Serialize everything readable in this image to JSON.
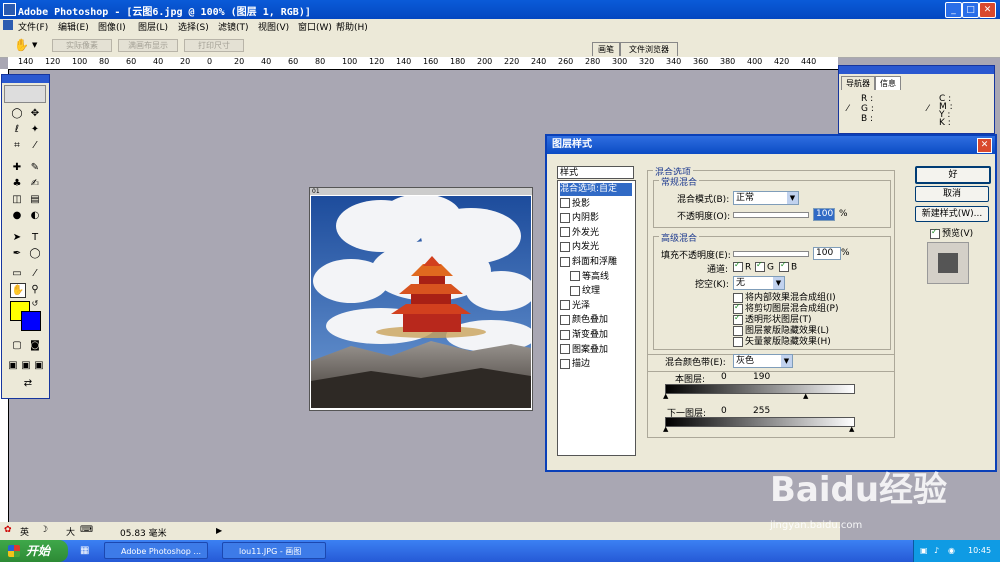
{
  "window": {
    "title": "Adobe Photoshop - [云图6.jpg @ 100% (图层 1, RGB)]",
    "minimize": "_",
    "maximize": "□",
    "close": "✕"
  },
  "menu": [
    "文件(F)",
    "编辑(E)",
    "图像(I)",
    "图层(L)",
    "选择(S)",
    "滤镜(T)",
    "视图(V)",
    "窗口(W)",
    "帮助(H)"
  ],
  "options": {
    "actual_pixels": "实际像素",
    "fit_screen": "满画布显示",
    "print_size": "打印尺寸",
    "tab_brush": "画笔",
    "tab_browser": "文件浏览器"
  },
  "ruler_ticks": [
    "140",
    "120",
    "100",
    "80",
    "60",
    "40",
    "20",
    "0",
    "20",
    "40",
    "60",
    "80",
    "100",
    "120",
    "140",
    "160",
    "180",
    "200",
    "220",
    "240",
    "260",
    "280",
    "300",
    "320",
    "340",
    "360",
    "380",
    "400",
    "420",
    "440"
  ],
  "navigator": {
    "tab_nav": "导航器",
    "tab_info": "信息",
    "rgb": [
      "R :",
      "G :",
      "B :"
    ],
    "cmyk": [
      "C :",
      "M :",
      "Y :",
      "K :"
    ]
  },
  "document": {
    "badge": "01"
  },
  "dialog": {
    "title": "图层样式",
    "list_header": "样式",
    "list": [
      {
        "label": "混合选项:自定",
        "checked": null,
        "selected": true,
        "indent": false
      },
      {
        "label": "投影",
        "checked": false,
        "selected": false,
        "indent": false
      },
      {
        "label": "内阴影",
        "checked": false,
        "selected": false,
        "indent": false
      },
      {
        "label": "外发光",
        "checked": false,
        "selected": false,
        "indent": false
      },
      {
        "label": "内发光",
        "checked": false,
        "selected": false,
        "indent": false
      },
      {
        "label": "斜面和浮雕",
        "checked": false,
        "selected": false,
        "indent": false
      },
      {
        "label": "等高线",
        "checked": false,
        "selected": false,
        "indent": true
      },
      {
        "label": "纹理",
        "checked": false,
        "selected": false,
        "indent": true
      },
      {
        "label": "光泽",
        "checked": false,
        "selected": false,
        "indent": false
      },
      {
        "label": "颜色叠加",
        "checked": false,
        "selected": false,
        "indent": false
      },
      {
        "label": "渐变叠加",
        "checked": false,
        "selected": false,
        "indent": false
      },
      {
        "label": "图案叠加",
        "checked": false,
        "selected": false,
        "indent": false
      },
      {
        "label": "描边",
        "checked": false,
        "selected": false,
        "indent": false
      }
    ],
    "blend_options": "混合选项",
    "general_blend": "常规混合",
    "blend_mode_label": "混合模式(B):",
    "blend_mode_value": "正常",
    "opacity_label": "不透明度(O):",
    "opacity_value": "100",
    "percent": "%",
    "advanced_blend": "高级混合",
    "fill_opacity_label": "填充不透明度(E):",
    "fill_opacity_value": "100",
    "channels_label": "通道:",
    "channels": [
      "R",
      "G",
      "B"
    ],
    "knockout_label": "挖空(K):",
    "knockout_value": "无",
    "adv_checks": [
      {
        "label": "将内部效果混合成组(I)",
        "checked": false
      },
      {
        "label": "将剪切图层混合成组(P)",
        "checked": true
      },
      {
        "label": "透明形状图层(T)",
        "checked": true
      },
      {
        "label": "图层蒙版隐藏效果(L)",
        "checked": false
      },
      {
        "label": "矢量蒙版隐藏效果(H)",
        "checked": false
      }
    ],
    "blend_if_label": "混合颜色带(E):",
    "blend_if_value": "灰色",
    "this_layer_label": "本图层:",
    "this_layer_low": "0",
    "this_layer_high": "190",
    "under_layer_label": "下一图层:",
    "under_layer_low": "0",
    "under_layer_high": "255",
    "ok": "好",
    "cancel": "取消",
    "new_style": "新建样式(W)...",
    "preview": "预览(V)"
  },
  "status": {
    "ime": "英",
    "ime_extra": "大",
    "value": "05.83 毫米"
  },
  "taskbar": {
    "start": "开始",
    "tasks": [
      "Adobe Photoshop ...",
      "lou11.JPG - 画图"
    ],
    "clock": "10:45"
  },
  "watermark": {
    "brand": "Baidu经验",
    "url": "jingyan.baidu.com"
  },
  "colors": {
    "titlebar": "#0a5bd8",
    "foreground_swatch": "#ffff00",
    "background_swatch": "#0000ff",
    "dialog_accent": "#0a40b8"
  }
}
